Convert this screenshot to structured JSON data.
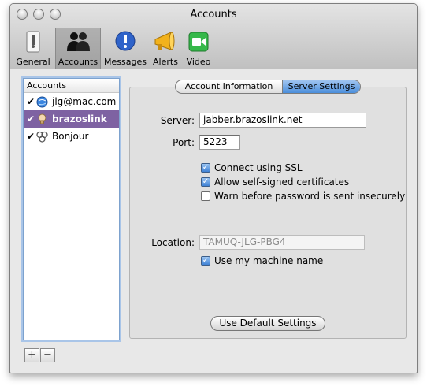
{
  "window": {
    "title": "Accounts"
  },
  "toolbar": {
    "items": [
      {
        "label": "General",
        "icon": "switch-icon"
      },
      {
        "label": "Accounts",
        "icon": "people-icon",
        "selected": true
      },
      {
        "label": "Messages",
        "icon": "alert-bubble-icon"
      },
      {
        "label": "Alerts",
        "icon": "megaphone-icon"
      },
      {
        "label": "Video",
        "icon": "video-camera-icon"
      }
    ]
  },
  "accounts": {
    "header": "Accounts",
    "items": [
      {
        "label": "jlg@mac.com",
        "checked": true,
        "icon": "mac-globe-icon"
      },
      {
        "label": "brazoslink",
        "checked": true,
        "icon": "lightbulb-icon",
        "selected": true
      },
      {
        "label": "Bonjour",
        "checked": true,
        "icon": "bonjour-icon"
      }
    ],
    "add_label": "+",
    "remove_label": "−"
  },
  "tabs": {
    "account_info": "Account Information",
    "server_settings": "Server Settings",
    "selected": "Server Settings"
  },
  "server": {
    "server_label": "Server:",
    "server_value": "jabber.brazoslink.net",
    "port_label": "Port:",
    "port_value": "5223",
    "ssl_label": "Connect using SSL",
    "ssl_checked": true,
    "self_signed_label": "Allow self-signed certificates",
    "self_signed_checked": true,
    "warn_label": "Warn before password is sent insecurely",
    "warn_checked": false,
    "location_label": "Location:",
    "location_value": "TAMUQ-JLG-PBG4",
    "machine_name_label": "Use my machine name",
    "machine_name_checked": true,
    "default_button": "Use Default Settings"
  },
  "colors": {
    "selection": "#7e62a2",
    "segment_selected": "#4c8fdc",
    "checkbox": "#3f82d6"
  }
}
